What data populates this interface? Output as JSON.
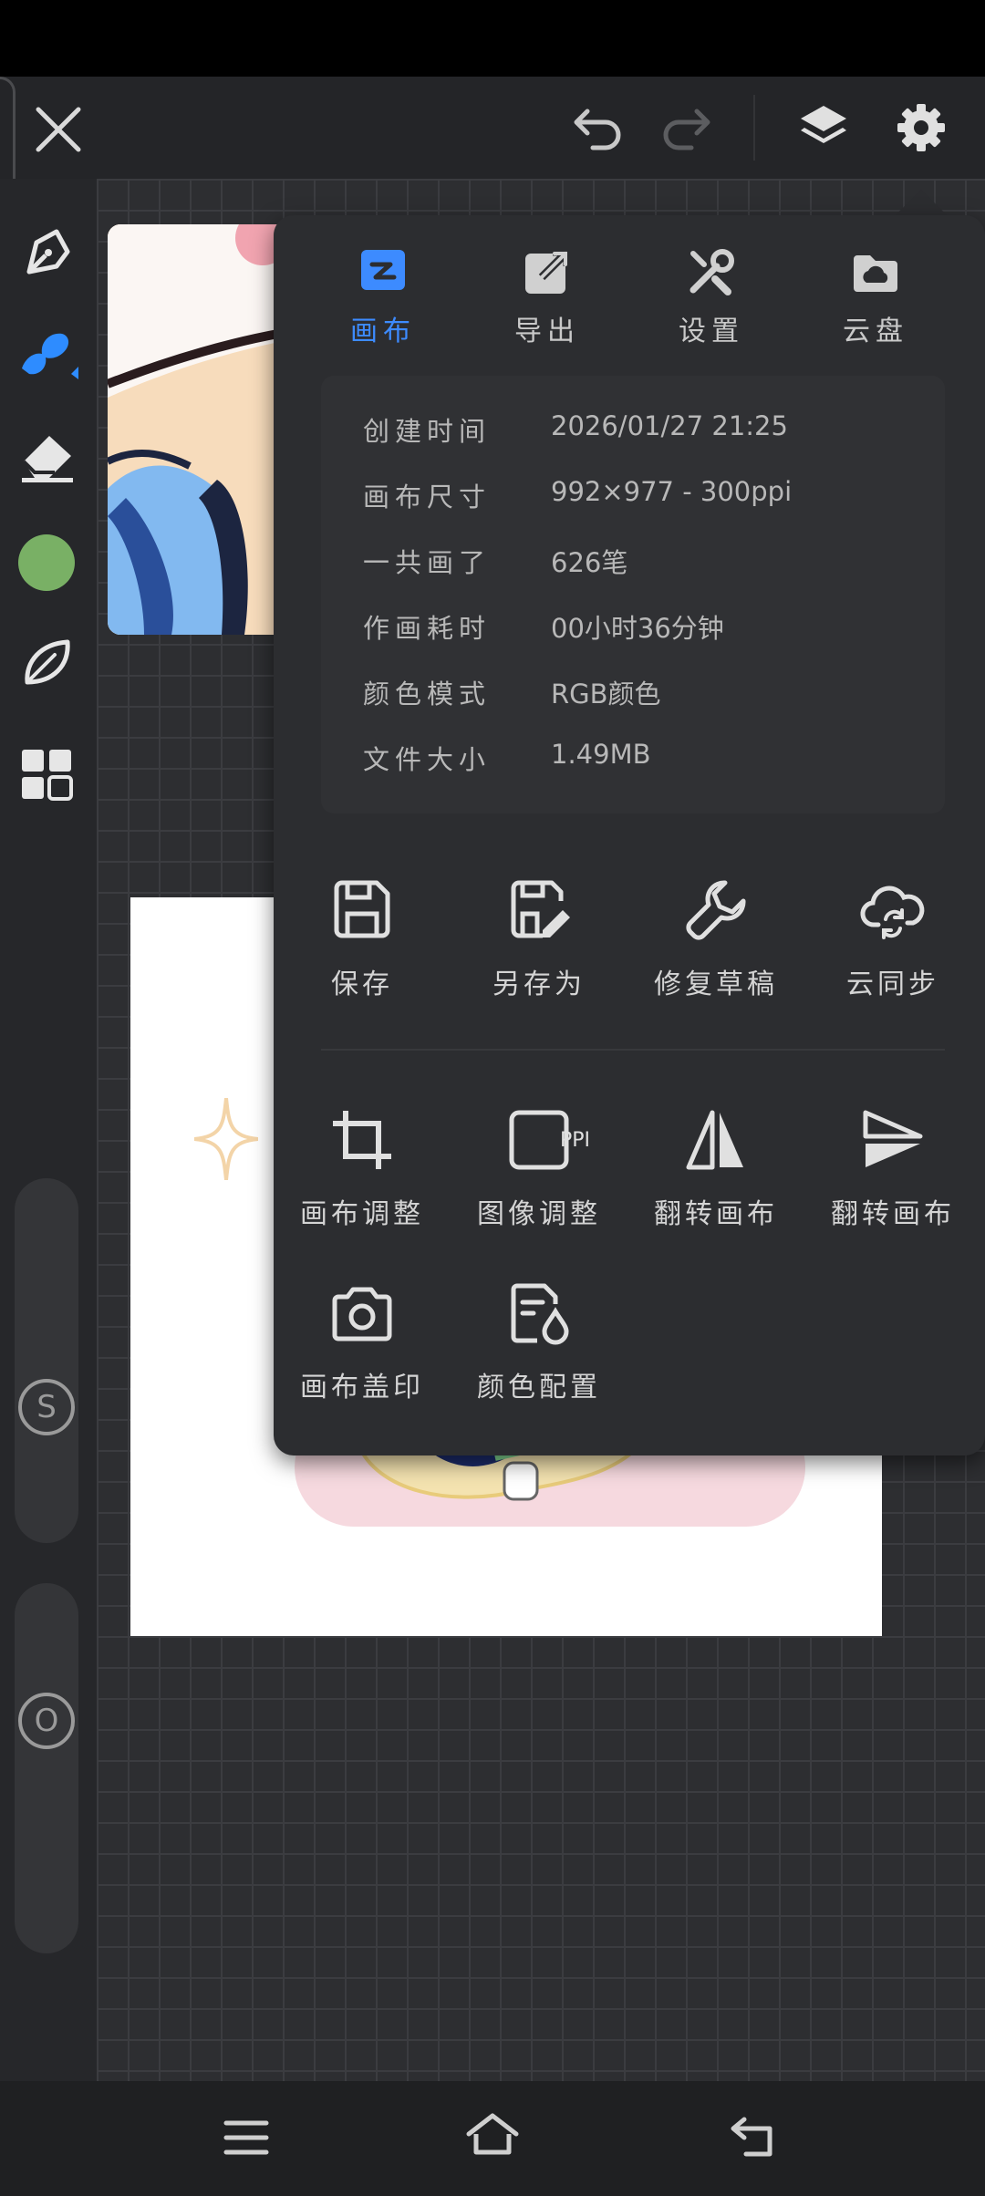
{
  "top_bar": {
    "close_icon": "close-icon",
    "undo_icon": "undo-icon",
    "redo_icon": "redo-icon",
    "layers_icon": "layers-icon",
    "settings_icon": "gear-icon"
  },
  "left_rail": {
    "tools": [
      "pen-icon",
      "brush-icon",
      "eraser-icon",
      "color-swatch",
      "leaf-icon",
      "grid-icon"
    ],
    "color": "#79b065",
    "brush_color": "#2e8cff",
    "size_slider_label": "S",
    "opacity_slider_label": "O"
  },
  "menu": {
    "tabs": [
      {
        "label": "画布",
        "icon": "canvas-icon",
        "active": true
      },
      {
        "label": "导出",
        "icon": "export-icon",
        "active": false
      },
      {
        "label": "设置",
        "icon": "tools-icon",
        "active": false
      },
      {
        "label": "云盘",
        "icon": "cloud-drive-icon",
        "active": false
      }
    ],
    "info": [
      {
        "label": "创建时间",
        "value": "2026/01/27 21:25"
      },
      {
        "label": "画布尺寸",
        "value": "992×977 - 300ppi"
      },
      {
        "label": "一共画了",
        "value": "626笔"
      },
      {
        "label": "作画耗时",
        "value": "00小时36分钟"
      },
      {
        "label": "颜色模式",
        "value": "RGB颜色"
      },
      {
        "label": "文件大小",
        "value": "1.49MB"
      }
    ],
    "actions_row1": [
      {
        "label": "保存",
        "icon": "save-icon"
      },
      {
        "label": "另存为",
        "icon": "save-as-icon"
      },
      {
        "label": "修复草稿",
        "icon": "wrench-icon"
      },
      {
        "label": "云同步",
        "icon": "cloud-sync-icon"
      }
    ],
    "actions_row2": [
      {
        "label": "画布调整",
        "icon": "crop-icon"
      },
      {
        "label": "图像调整",
        "icon": "ppi-icon",
        "icon_text": "PPI"
      },
      {
        "label": "翻转画布",
        "icon": "flip-horizontal-icon"
      },
      {
        "label": "翻转画布",
        "icon": "flip-vertical-icon"
      }
    ],
    "actions_row3": [
      {
        "label": "画布盖印",
        "icon": "camera-icon"
      },
      {
        "label": "颜色配置",
        "icon": "color-profile-icon"
      }
    ]
  },
  "nav_bar": {
    "menu_icon": "menu-icon",
    "home_icon": "home-icon",
    "back_icon": "back-icon"
  },
  "colors": {
    "accent": "#3d8bff",
    "panel": "#2c2d30",
    "canvas_bg": "#2d2e31"
  }
}
